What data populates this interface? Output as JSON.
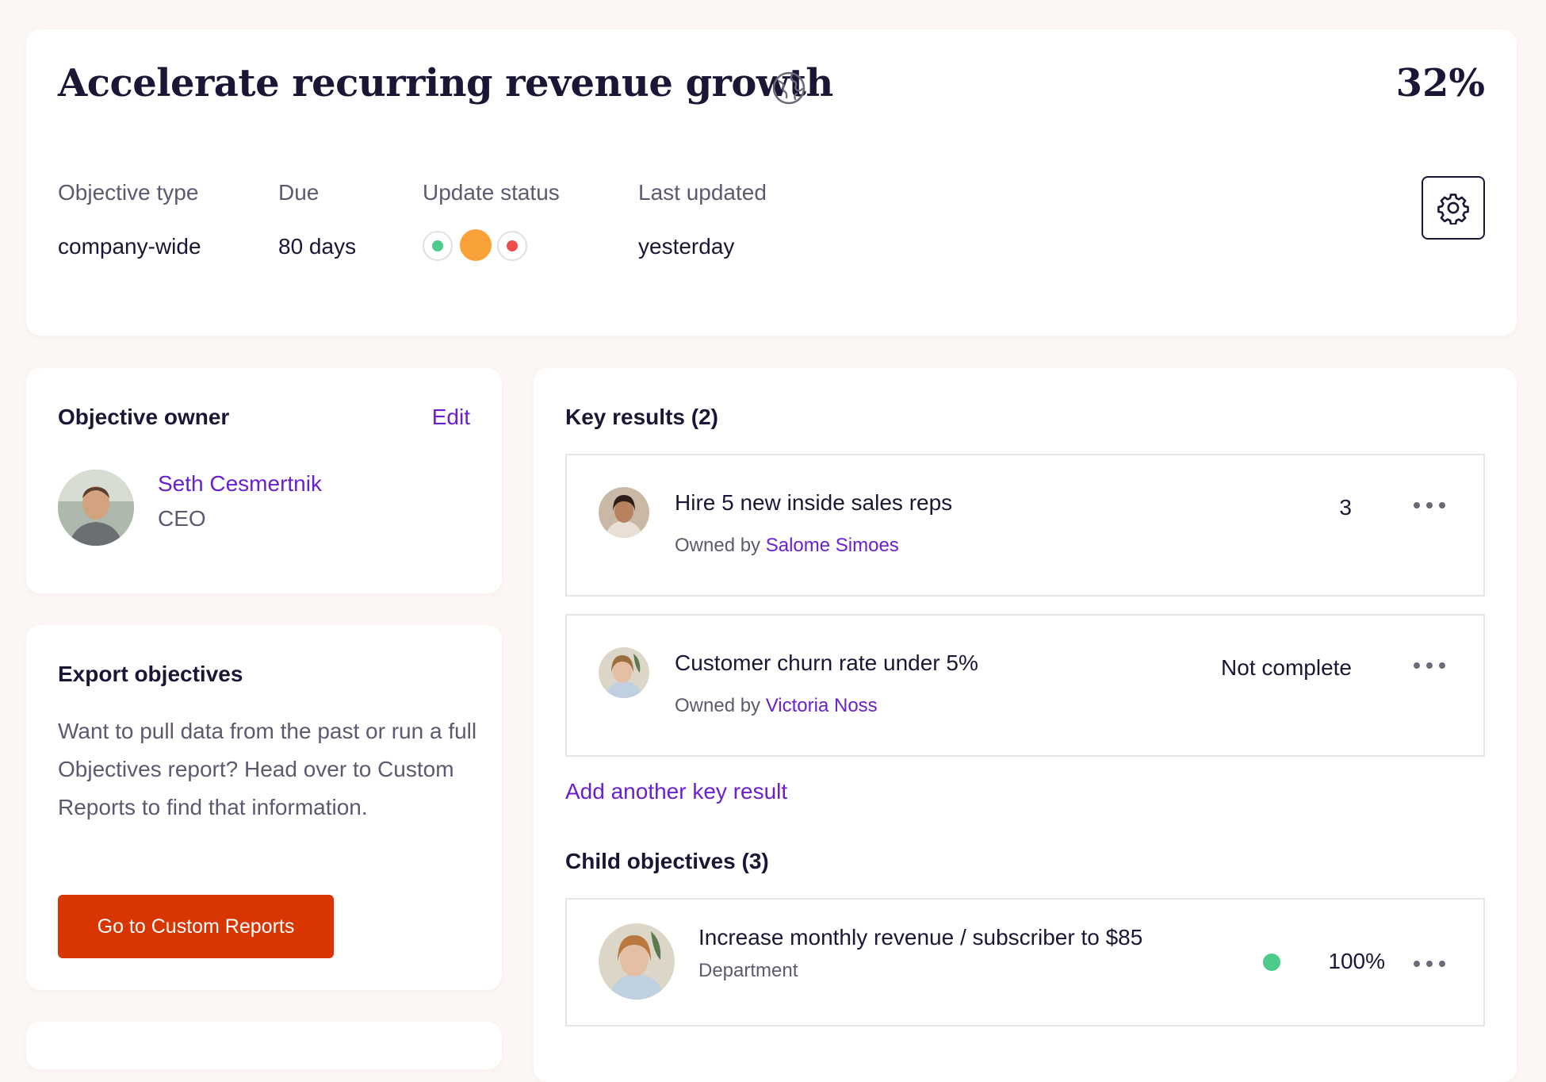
{
  "objective": {
    "title": "Accelerate recurring revenue growth",
    "progress": "32%",
    "visibility_icon": "globe-icon"
  },
  "meta": {
    "type_label": "Objective type",
    "type_value": "company-wide",
    "due_label": "Due",
    "due_value": "80 days",
    "status_label": "Update status",
    "status_dots": [
      "#4ccb8a",
      "#f9a23a",
      "#f04e4e"
    ],
    "updated_label": "Last updated",
    "updated_value": "yesterday",
    "settings_icon": "gear-icon"
  },
  "owner_card": {
    "heading": "Objective owner",
    "edit_label": "Edit",
    "name": "Seth Cesmertnik",
    "role": "CEO"
  },
  "export_card": {
    "heading": "Export objectives",
    "text": "Want to pull data from the past or run a full Objectives report? Head over to Custom Reports to find that information.",
    "button_label": "Go to Custom Reports"
  },
  "key_results": {
    "heading": "Key results (2)",
    "items": [
      {
        "title": "Hire 5 new inside sales reps",
        "owned_by_prefix": "Owned by ",
        "owner": "Salome Simoes",
        "value": "3"
      },
      {
        "title": "Customer churn rate under 5%",
        "owned_by_prefix": "Owned by ",
        "owner": "Victoria Noss",
        "value": "Not complete"
      }
    ],
    "add_label": "Add another key result"
  },
  "child_objectives": {
    "heading": "Child objectives (3)",
    "items": [
      {
        "title": "Increase monthly revenue / subscriber to $85",
        "type": "Department",
        "status_color": "#4ccb8a",
        "progress": "100%"
      }
    ]
  },
  "colors": {
    "accent": "#6a1fd1",
    "primary_button": "#d93500",
    "background": "#fcf7f5"
  }
}
